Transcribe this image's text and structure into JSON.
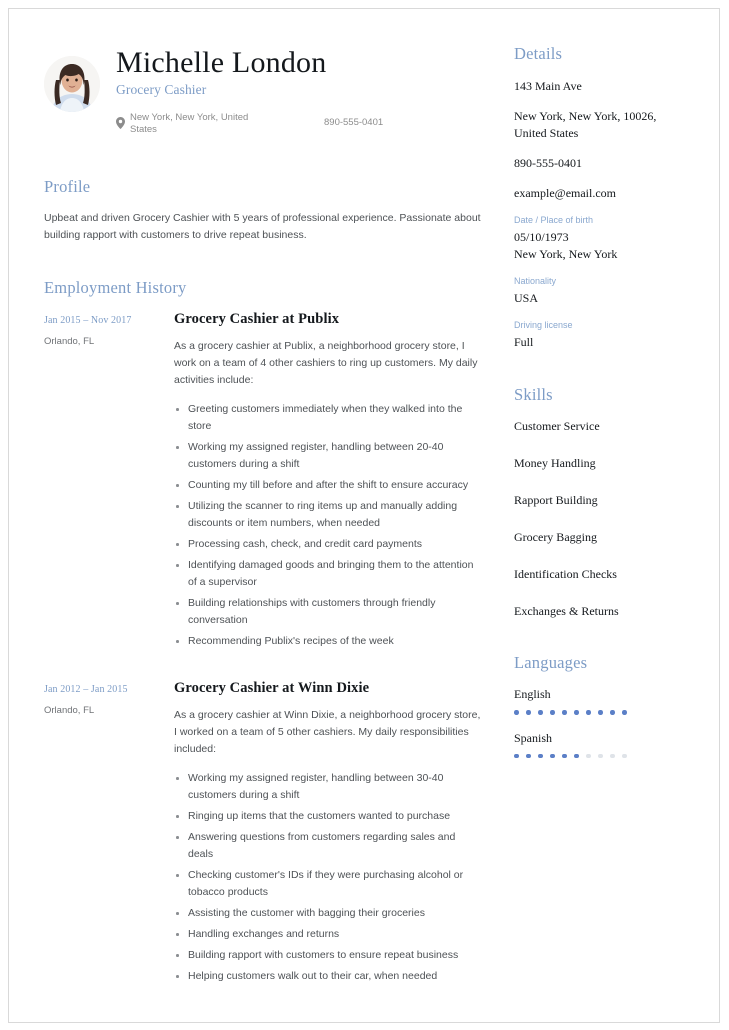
{
  "theme": {
    "accent": "#7d9cc6",
    "dot_filled": "#5b7fc7",
    "dot_empty": "#dfe3e8",
    "text_dark": "#14181c",
    "text_body": "#4e5256"
  },
  "header": {
    "name": "Michelle London",
    "job_title": "Grocery Cashier",
    "location": "New York, New York, United States",
    "phone": "890-555-0401",
    "location_icon": "map-pin-icon",
    "avatar_icon": "profile-photo"
  },
  "profile": {
    "heading": "Profile",
    "text": "Upbeat and driven Grocery Cashier with 5 years of professional experience. Passionate about building rapport with customers to drive repeat business."
  },
  "employment": {
    "heading": "Employment History",
    "jobs": [
      {
        "date": "Jan 2015 – Nov 2017",
        "location": "Orlando, FL",
        "title": "Grocery Cashier at Publix",
        "summary": "As a grocery cashier at Publix, a neighborhood grocery store, I work on a team of 4 other cashiers to ring up customers. My daily activities include:",
        "bullets": [
          "Greeting customers immediately when they walked into the store",
          "Working my assigned register, handling between 20-40 customers during a shift",
          "Counting my till before and after the shift to ensure accuracy",
          "Utilizing the scanner to ring items up and manually adding discounts or item numbers, when needed",
          "Processing cash, check, and credit card payments",
          "Identifying damaged goods and bringing them to the attention of a supervisor",
          "Building relationships with customers through friendly conversation",
          "Recommending Publix's recipes of the week"
        ]
      },
      {
        "date": "Jan 2012 – Jan 2015",
        "location": "Orlando, FL",
        "title": "Grocery Cashier at Winn Dixie",
        "summary": "As a grocery cashier at Winn Dixie, a neighborhood grocery store, I worked on a team of 5 other cashiers. My daily responsibilities included:",
        "bullets": [
          "Working my assigned register, handling between 30-40 customers during a shift",
          "Ringing up items that the customers wanted to purchase",
          "Answering questions from customers regarding sales and deals",
          "Checking customer's IDs if they were purchasing alcohol or tobacco products",
          "Assisting the customer with bagging their groceries",
          "Handling exchanges and returns",
          "Building rapport with customers to ensure repeat business",
          "Helping customers walk out to their car, when needed"
        ]
      }
    ]
  },
  "details": {
    "heading": "Details",
    "address_line1": "143 Main Ave",
    "address_line2": "New York, New York, 10026, United States",
    "phone": "890-555-0401",
    "email": "example@email.com",
    "birth_label": "Date / Place of birth",
    "birth_date": "05/10/1973",
    "birth_place": "New York, New York",
    "nationality_label": "Nationality",
    "nationality": "USA",
    "license_label": "Driving license",
    "license": "Full"
  },
  "skills": {
    "heading": "Skills",
    "items": [
      "Customer Service",
      "Money Handling",
      "Rapport Building",
      "Grocery Bagging",
      "Identification Checks",
      "Exchanges & Returns"
    ]
  },
  "languages": {
    "heading": "Languages",
    "items": [
      {
        "name": "English",
        "level": 10,
        "max": 10
      },
      {
        "name": "Spanish",
        "level": 6,
        "max": 10
      }
    ]
  }
}
